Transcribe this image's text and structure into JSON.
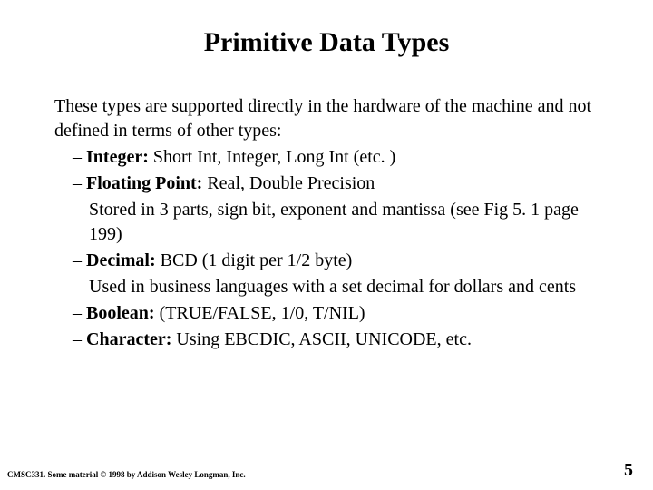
{
  "title": "Primitive Data Types",
  "intro": "These types are supported directly in the hardware of the machine and not defined in terms of other types:",
  "bullets": {
    "integer": {
      "label": "Integer:",
      "text": "  Short Int, Integer, Long Int (etc. )"
    },
    "float": {
      "label": "Floating Point:",
      "text": "  Real, Double Precision"
    },
    "float_sub": "Stored in 3 parts, sign bit, exponent and mantissa (see Fig 5. 1 page 199)",
    "decimal": {
      "label": "Decimal:",
      "text": "  BCD (1 digit per 1/2 byte)"
    },
    "decimal_sub": "Used in business languages with a set decimal for dollars and cents",
    "boolean": {
      "label": "Boolean:",
      "text": " (TRUE/FALSE, 1/0, T/NIL)"
    },
    "character": {
      "label": "Character:",
      "text": "  Using EBCDIC, ASCII, UNICODE, etc."
    }
  },
  "dash": "– ",
  "footer": "CMSC331.  Some material © 1998 by Addison Wesley Longman, Inc.",
  "page": "5"
}
